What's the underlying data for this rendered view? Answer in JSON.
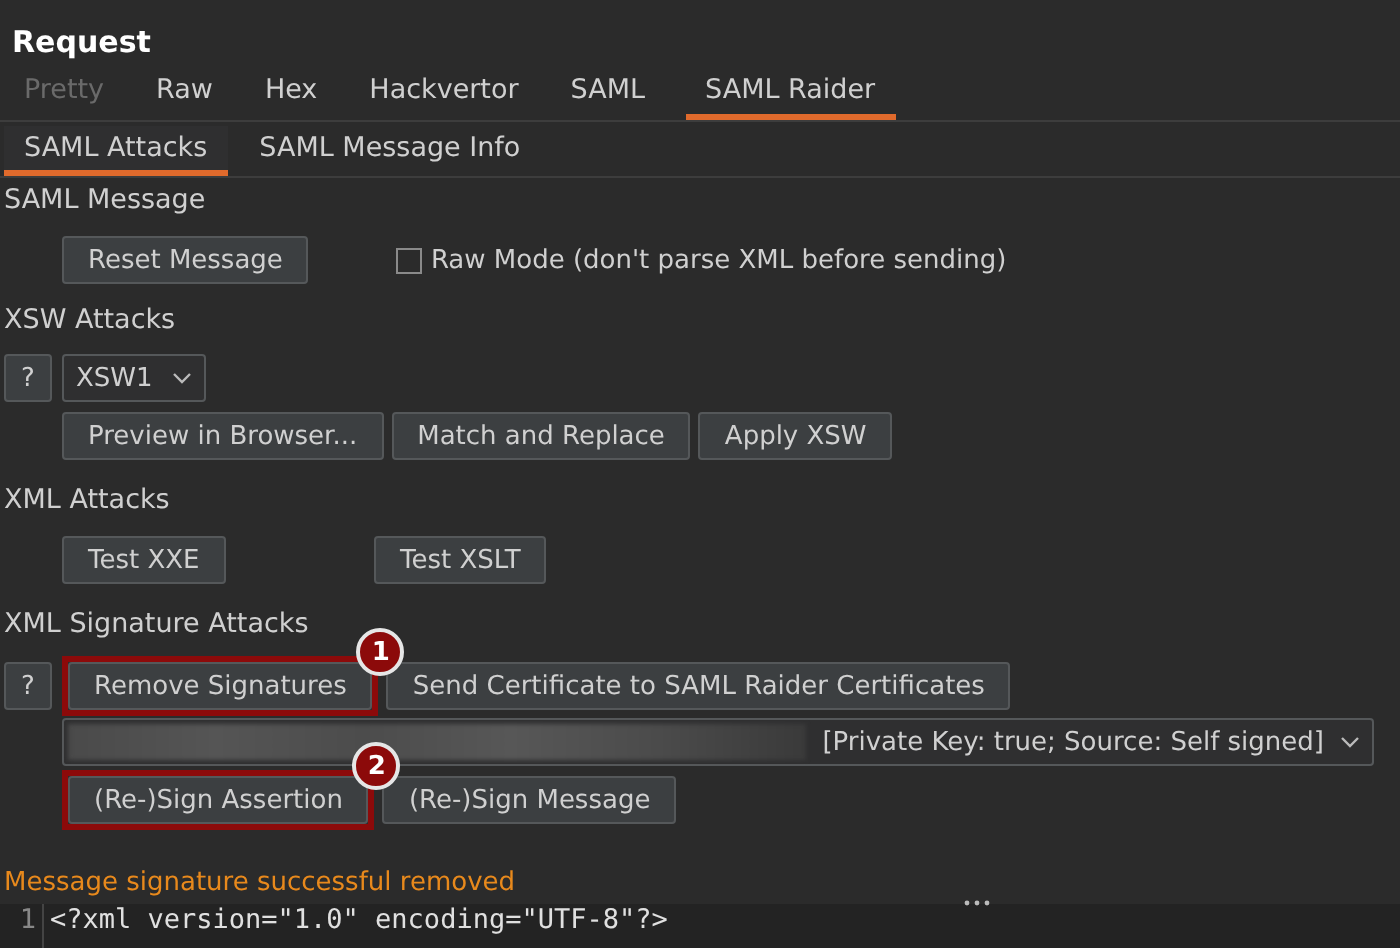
{
  "title": "Request",
  "tabs": [
    {
      "label": "Pretty",
      "selected": false,
      "disabled": true
    },
    {
      "label": "Raw",
      "selected": false,
      "disabled": false
    },
    {
      "label": "Hex",
      "selected": false,
      "disabled": false
    },
    {
      "label": "Hackvertor",
      "selected": false,
      "disabled": false
    },
    {
      "label": "SAML",
      "selected": false,
      "disabled": false
    },
    {
      "label": "SAML Raider",
      "selected": true,
      "disabled": false
    }
  ],
  "subtabs": [
    {
      "label": "SAML Attacks",
      "selected": true
    },
    {
      "label": "SAML Message Info",
      "selected": false
    }
  ],
  "saml_message": {
    "heading": "SAML Message",
    "reset_button": "Reset Message",
    "raw_mode": {
      "label": "Raw Mode (don't parse XML before sending)",
      "checked": false
    }
  },
  "xsw_attacks": {
    "heading": "XSW Attacks",
    "help": "?",
    "select": {
      "value": "XSW1"
    },
    "buttons": [
      {
        "label": "Preview in Browser..."
      },
      {
        "label": "Match and Replace"
      },
      {
        "label": "Apply XSW"
      }
    ]
  },
  "xml_attacks": {
    "heading": "XML Attacks",
    "buttons": [
      {
        "label": "Test XXE"
      },
      {
        "label": "Test XSLT"
      }
    ]
  },
  "signature_attacks": {
    "heading": "XML Signature Attacks",
    "help": "?",
    "buttons": [
      {
        "label": "Remove Signatures",
        "callout": "1"
      },
      {
        "label": "Send Certificate to SAML Raider Certificates"
      }
    ],
    "certificate_select": {
      "value": "[Private Key: true; Source: Self signed]"
    },
    "sign_buttons": [
      {
        "label": "(Re-)Sign Assertion",
        "callout": "2"
      },
      {
        "label": "(Re-)Sign Message"
      }
    ]
  },
  "status_message": "Message signature successful removed",
  "editor": {
    "lines": [
      {
        "number": "1",
        "text": "<?xml version=\"1.0\" encoding=\"UTF-8\"?>"
      }
    ]
  }
}
